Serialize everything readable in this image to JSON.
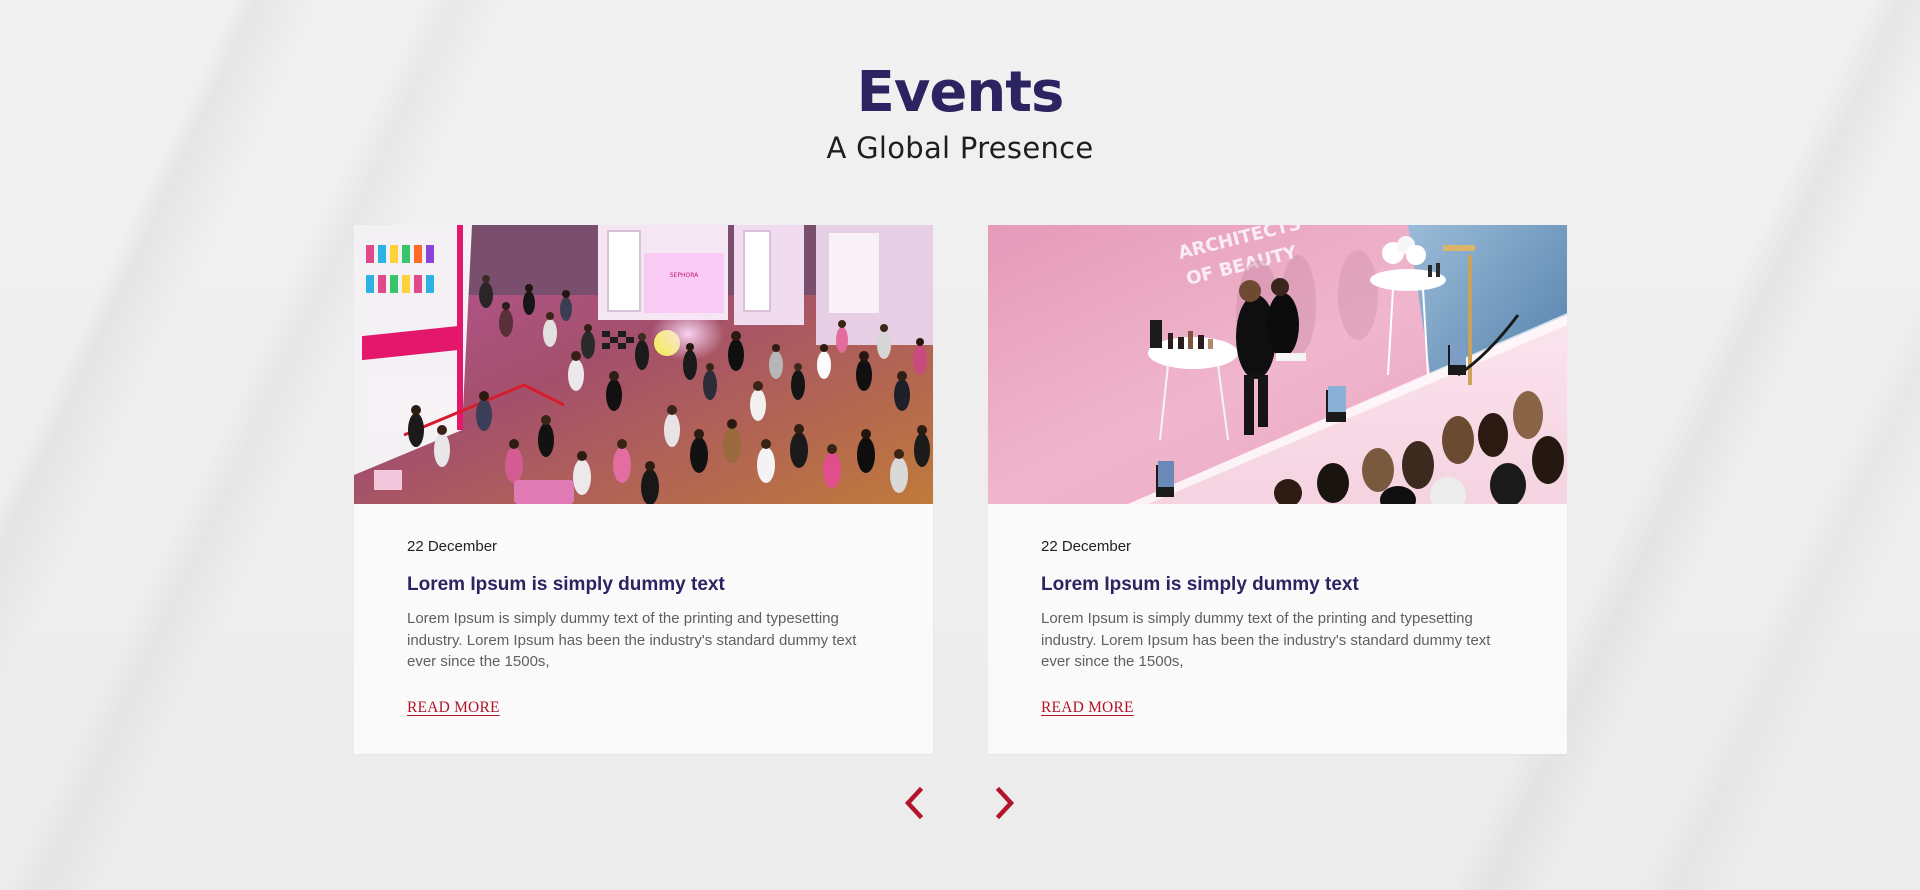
{
  "header": {
    "title": "Events",
    "subtitle": "A Global Presence"
  },
  "events": [
    {
      "date": "22 December",
      "title": "Lorem Ipsum is simply dummy text",
      "description": "Lorem Ipsum is simply dummy text of the printing and typesetting industry. Lorem Ipsum has been the industry's standard dummy text ever since the 1500s,",
      "link_label": "READ MORE",
      "image": {
        "subject": "crowd at a retail cosmetics launch event",
        "sign_text": "SEPHORA"
      }
    },
    {
      "date": "22 December",
      "title": "Lorem Ipsum is simply dummy text",
      "description": "Lorem Ipsum is simply dummy text of the printing and typesetting industry. Lorem Ipsum has been the industry's standard dummy text ever since the 1500s,",
      "link_label": "READ MORE",
      "image": {
        "subject": "makeup artist demo on pink stage",
        "wall_text_1": "ARCHITECTS",
        "wall_text_2": "OF BEAUTY"
      }
    }
  ],
  "navigation": {
    "prev_icon": "chevron-left-icon",
    "next_icon": "chevron-right-icon"
  },
  "colors": {
    "title": "#2b2461",
    "accent": "#b3142a",
    "body_text": "#5f5f5f",
    "card_bg": "#fafafa",
    "page_bg": "#eeeeee"
  }
}
